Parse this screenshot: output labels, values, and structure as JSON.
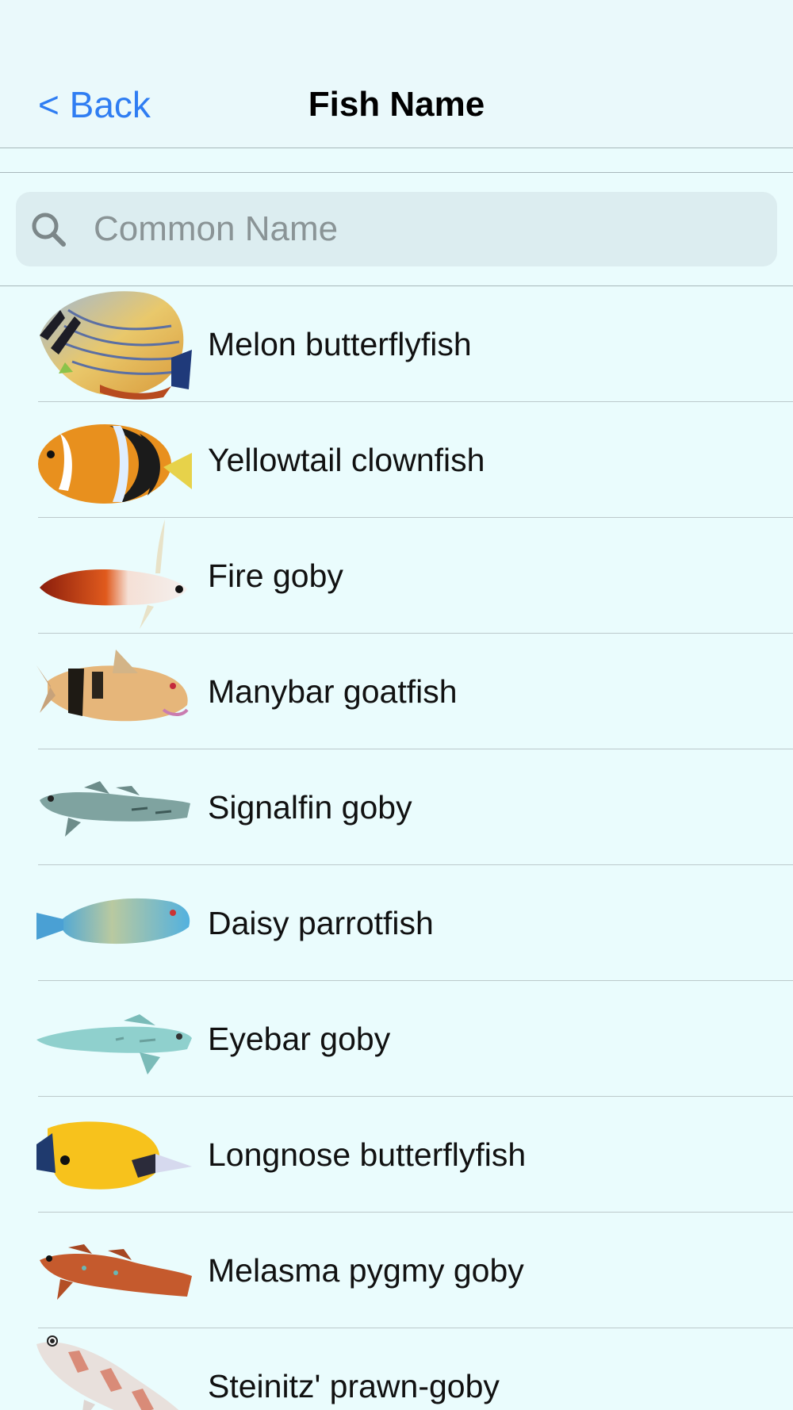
{
  "nav": {
    "back_label": "< Back",
    "title": "Fish Name"
  },
  "search": {
    "placeholder": "Common Name",
    "value": ""
  },
  "fish": [
    {
      "name": "Melon butterflyfish",
      "icon": "melon-butterflyfish-image"
    },
    {
      "name": "Yellowtail clownfish",
      "icon": "yellowtail-clownfish-image"
    },
    {
      "name": "Fire goby",
      "icon": "fire-goby-image"
    },
    {
      "name": "Manybar goatfish",
      "icon": "manybar-goatfish-image"
    },
    {
      "name": "Signalfin goby",
      "icon": "signalfin-goby-image"
    },
    {
      "name": "Daisy parrotfish",
      "icon": "daisy-parrotfish-image"
    },
    {
      "name": "Eyebar goby",
      "icon": "eyebar-goby-image"
    },
    {
      "name": "Longnose butterflyfish",
      "icon": "longnose-butterflyfish-image"
    },
    {
      "name": "Melasma pygmy goby",
      "icon": "melasma-pygmy-goby-image"
    },
    {
      "name": "Steinitz' prawn-goby",
      "icon": "steinitz-prawn-goby-image"
    }
  ],
  "colors": {
    "background": "#eafcfd",
    "accent": "#2f7df2",
    "search_field": "#dcedf0"
  }
}
